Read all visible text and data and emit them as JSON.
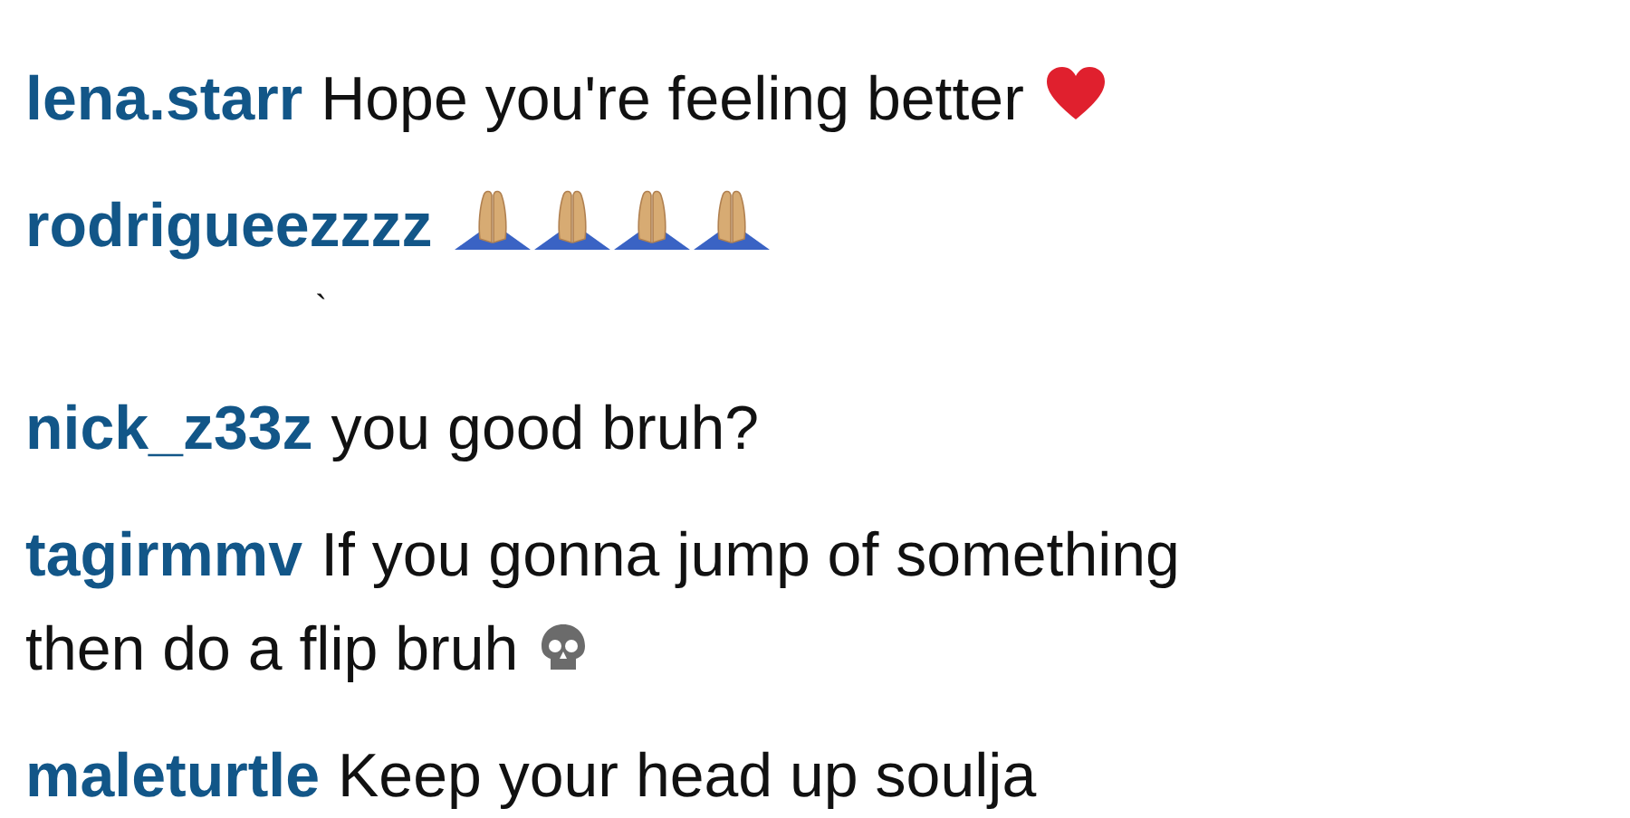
{
  "comments": [
    {
      "kind": "comment",
      "username": "lena.starr",
      "text": "Hope you're feeling better",
      "icons": [
        {
          "kind": "heart"
        }
      ]
    },
    {
      "kind": "comment",
      "username": "rodrigueezzzz",
      "icons": [
        {
          "kind": "praying-hands"
        },
        {
          "kind": "praying-hands"
        },
        {
          "kind": "praying-hands"
        },
        {
          "kind": "praying-hands"
        }
      ]
    },
    {
      "kind": "mark",
      "text": "`"
    },
    {
      "kind": "comment",
      "username": "nick_z33z",
      "text": "you good bruh?"
    },
    {
      "kind": "comment",
      "username": "tagirmmv",
      "text": "If you gonna jump of something then do a flip bruh",
      "icons": [
        {
          "kind": "skull"
        }
      ]
    },
    {
      "kind": "comment",
      "username": "maleturtle",
      "text": "Keep your head up soulja"
    }
  ]
}
